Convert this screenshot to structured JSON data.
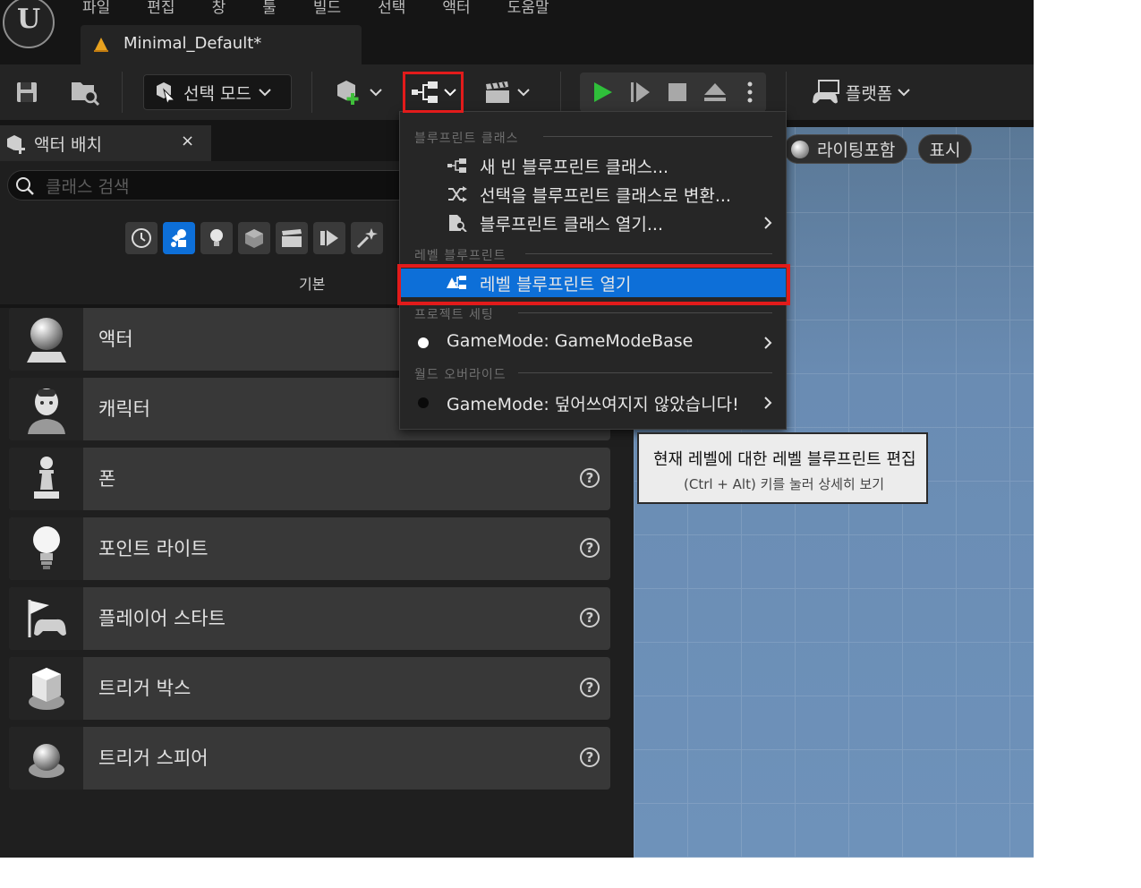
{
  "menu": [
    "파일",
    "편집",
    "창",
    "툴",
    "빌드",
    "선택",
    "액터",
    "도움말"
  ],
  "document_tab": {
    "label": "Minimal_Default*"
  },
  "toolbar": {
    "mode_label": "선택 모드",
    "platform_label": "플랫폼"
  },
  "place_actors_panel": {
    "title": "액터 배치",
    "close_glyph": "×",
    "search_placeholder": "클래스 검색",
    "category_label": "기본",
    "items": [
      {
        "name": "액터",
        "help": false
      },
      {
        "name": "캐릭터",
        "help": false
      },
      {
        "name": "폰",
        "help": true
      },
      {
        "name": "포인트 라이트",
        "help": true
      },
      {
        "name": "플레이어 스타트",
        "help": true
      },
      {
        "name": "트리거 박스",
        "help": true
      },
      {
        "name": "트리거 스피어",
        "help": true
      }
    ],
    "help_glyph": "?"
  },
  "viewport": {
    "lighting_label": "라이팅포함",
    "show_label": "표시"
  },
  "blueprint_menu": {
    "section_blueprint_classes": "블루프린트 클래스",
    "new_empty_blueprint": "새 빈 블루프린트 클래스...",
    "convert_selection": "선택을 블루프린트 클래스로 변환...",
    "open_blueprint_class": "블루프린트 클래스 열기...",
    "section_level_blueprint": "레벨 블루프린트",
    "open_level_blueprint": "레벨 블루프린트 열기",
    "section_project_settings": "프로젝트 세팅",
    "project_gamemode": "GameMode: GameModeBase",
    "section_world_override": "월드 오버라이드",
    "world_gamemode": "GameMode: 덮어쓰여지지 않았습니다!"
  },
  "tooltip": {
    "line1": "현재 레벨에 대한 레벨 블루프린트 편집",
    "line2": "(Ctrl + Alt) 키를 눌러 상세히 보기"
  },
  "colors": {
    "accent_blue": "#0d6fd8",
    "highlight_red": "#e21b1b",
    "play_green": "#2fbf3a"
  }
}
